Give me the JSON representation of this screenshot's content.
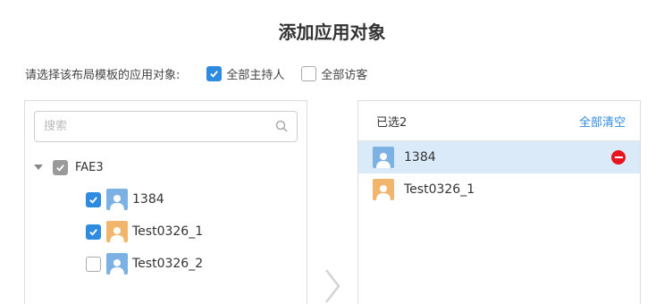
{
  "dialog": {
    "title": "添加应用对象"
  },
  "target": {
    "label": "请选择该布局模板的应用对象:",
    "options": [
      {
        "label": "全部主持人",
        "checked": true
      },
      {
        "label": "全部访客",
        "checked": false
      }
    ]
  },
  "left_panel": {
    "search_placeholder": "搜索",
    "root": {
      "label": "FAE3",
      "checked": "partial",
      "expanded": true
    },
    "items": [
      {
        "label": "1384",
        "checked": true,
        "avatar_color": "#7cb2e3"
      },
      {
        "label": "Test0326_1",
        "checked": true,
        "avatar_color": "#f2b56d"
      },
      {
        "label": "Test0326_2",
        "checked": false,
        "avatar_color": "#7cb2e3"
      }
    ]
  },
  "right_panel": {
    "count_label": "已选2",
    "clear_label": "全部清空",
    "items": [
      {
        "label": "1384",
        "selected": true,
        "avatar_color": "#7cb2e3"
      },
      {
        "label": "Test0326_1",
        "selected": false,
        "avatar_color": "#f2b56d"
      }
    ]
  },
  "colors": {
    "accent": "#2f8be0",
    "remove": "#e8141e",
    "selected_row": "#dbeaf8"
  }
}
